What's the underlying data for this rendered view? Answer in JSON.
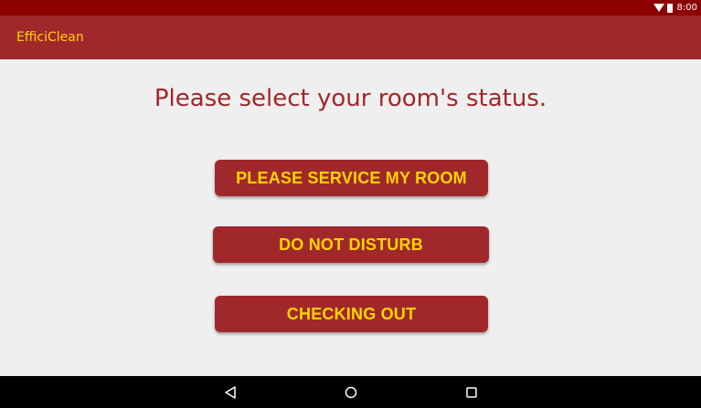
{
  "status_bar": {
    "time": "8:00",
    "icons": [
      "wifi-icon",
      "battery-icon"
    ],
    "background": "#8b0000"
  },
  "app_bar": {
    "title": "EfficiClean",
    "background": "#a0282b",
    "title_color": "#ffd400"
  },
  "main": {
    "prompt": "Please select your room's status.",
    "buttons": [
      {
        "label": "PLEASE SERVICE MY ROOM"
      },
      {
        "label": "DO NOT DISTURB"
      },
      {
        "label": "CHECKING OUT"
      }
    ],
    "accent": "#a0282b",
    "button_text_color": "#ffd400"
  },
  "nav_bar": {
    "icons": [
      "back-icon",
      "home-icon",
      "recents-icon"
    ]
  }
}
